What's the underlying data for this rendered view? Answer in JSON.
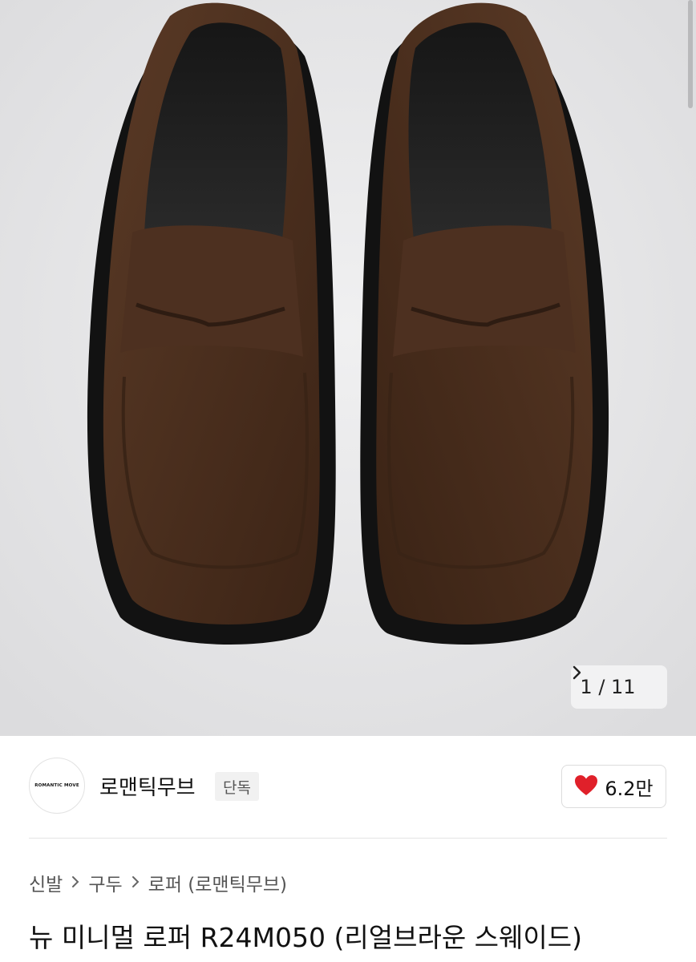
{
  "gallery": {
    "image_alt": "brown suede penny loafers",
    "counter_text": "1 / 11",
    "next_icon": "chevron-right-icon"
  },
  "brand": {
    "logo_text": "ROMANTIC MOVE",
    "name": "로맨틱무브",
    "badge": "단독"
  },
  "like": {
    "icon": "heart-icon",
    "color": "#e0202a",
    "count": "6.2만"
  },
  "breadcrumb": {
    "items": [
      "신발",
      "구두",
      "로퍼 (로맨틱무브)"
    ],
    "separator_icon": "chevron-right-icon"
  },
  "product": {
    "title": "뉴 미니멀 로퍼 R24M050 (리얼브라운 스웨이드)"
  }
}
